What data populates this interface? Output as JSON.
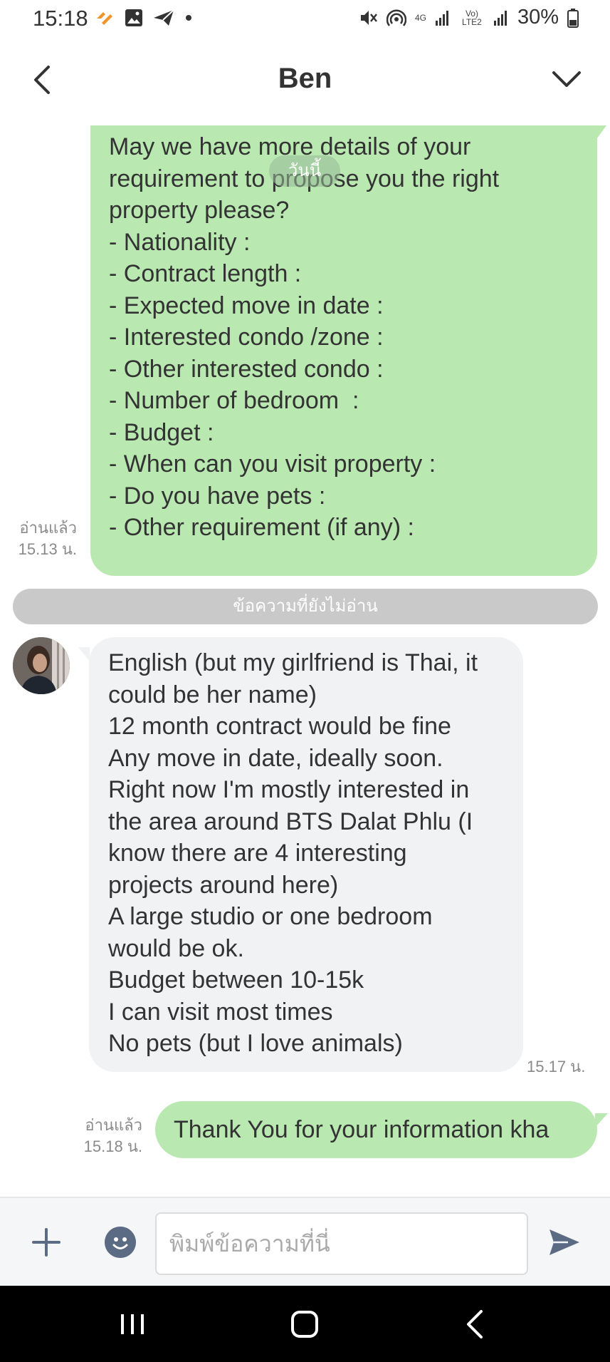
{
  "status_bar": {
    "time": "15:18",
    "network_label": "4G",
    "volte_label": "Vo) LTE2",
    "battery": "30%",
    "icons": [
      "notification-app-icon",
      "image-icon",
      "send-icon",
      "dot-icon",
      "mute-icon",
      "hotspot-icon",
      "signal-icon",
      "signal-icon",
      "battery-icon"
    ]
  },
  "header": {
    "title": "Ben",
    "back_icon": "chevron-left-icon",
    "menu_icon": "chevron-down-icon"
  },
  "chat": {
    "date_divider": "วันนี้",
    "messages": [
      {
        "direction": "outgoing",
        "lines": [
          "May we have more details of your",
          "requirement to propose you the right",
          "property please?",
          "- Nationality :",
          "- Contract length :",
          "- Expected move in date :",
          "- Interested condo /zone :",
          "- Other interested condo :",
          "- Number of bedroom  :",
          "- Budget :",
          "- When can you visit property :",
          "- Do you have pets :",
          "- Other requirement (if any) :"
        ],
        "read_label": "อ่านแล้ว",
        "time": "15.13 น."
      },
      {
        "direction": "incoming",
        "lines": [
          "English (but my girlfriend is Thai, it",
          "could be her name)",
          "12 month contract would be fine",
          "Any move in date, ideally soon.",
          "Right now I'm mostly interested in",
          "the area around BTS Dalat Phlu (I",
          "know there are 4 interesting",
          "projects around here)",
          "A large studio or one bedroom",
          "would be ok.",
          "Budget between 10-15k",
          "I can visit most times",
          "No pets (but I love animals)"
        ],
        "time": "15.17 น."
      },
      {
        "direction": "outgoing",
        "text": "Thank You for your  information kha",
        "read_label": "อ่านแล้ว",
        "time": "15.18 น."
      }
    ],
    "unread_divider": "ข้อความที่ยังไม่อ่าน"
  },
  "input_bar": {
    "placeholder": "พิมพ์ข้อความที่นี่",
    "icons": [
      "plus-icon",
      "emoji-icon",
      "send-icon"
    ]
  },
  "nav_bar": {
    "icons": [
      "recent-apps-icon",
      "home-icon",
      "back-icon"
    ]
  },
  "colors": {
    "outgoing_bubble": "#b9e8b1",
    "incoming_bubble": "#f1f2f4",
    "unread_divider": "#c9c9c9",
    "meta_text": "#8a8a8a"
  }
}
